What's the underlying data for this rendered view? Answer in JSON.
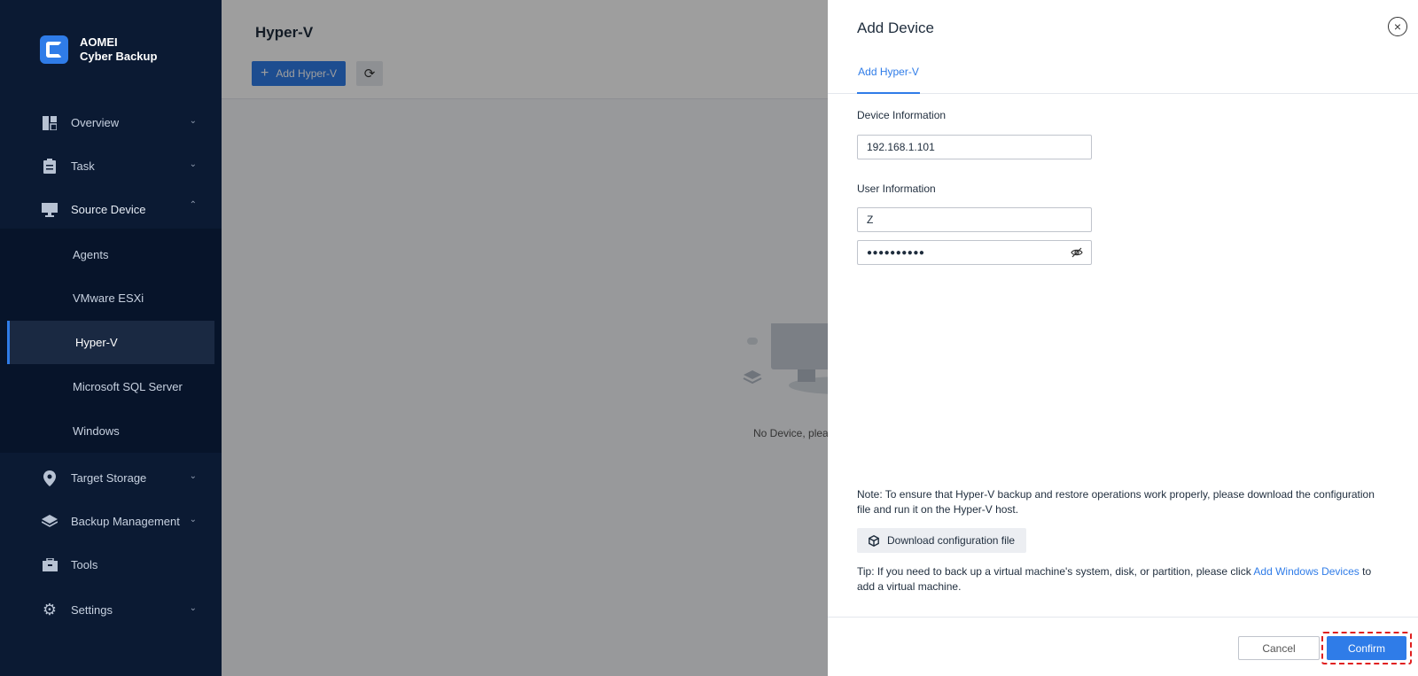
{
  "app": {
    "brand_line1": "AOMEI",
    "brand_line2": "Cyber Backup"
  },
  "sidebar": {
    "items": [
      {
        "label": "Overview",
        "icon": "overview-icon"
      },
      {
        "label": "Task",
        "icon": "task-icon"
      },
      {
        "label": "Source Device",
        "icon": "monitor-icon",
        "expanded": true
      },
      {
        "label": "Target Storage",
        "icon": "location-pin-icon"
      },
      {
        "label": "Backup Management",
        "icon": "layers-icon"
      },
      {
        "label": "Tools",
        "icon": "toolbox-icon"
      },
      {
        "label": "Settings",
        "icon": "gear-icon"
      }
    ],
    "sub_items": [
      {
        "label": "Agents"
      },
      {
        "label": "VMware ESXi"
      },
      {
        "label": "Hyper-V",
        "active": true
      },
      {
        "label": "Microsoft SQL Server"
      },
      {
        "label": "Windows"
      }
    ]
  },
  "main": {
    "title": "Hyper-V",
    "add_button": "Add Hyper-V",
    "empty_text": "No Device, pleas"
  },
  "drawer": {
    "title": "Add Device",
    "tab": "Add Hyper-V",
    "device_info_label": "Device Information",
    "device_ip": "192.168.1.101",
    "user_info_label": "User Information",
    "username": "Z",
    "password_mask": "●●●●●●●●●●",
    "note": "Note: To ensure that Hyper-V backup and restore operations work properly, please download the configuration file and run it on the Hyper-V host.",
    "download_button": "Download configuration file",
    "tip_prefix": "Tip: If you need to back up a virtual machine's system, disk, or partition, please click ",
    "tip_link": "Add Windows Devices",
    "tip_suffix": " to add a virtual machine.",
    "cancel_button": "Cancel",
    "confirm_button": "Confirm"
  },
  "colors": {
    "accent": "#2f7ce8",
    "sidebar_bg": "#0b1a33",
    "highlight": "#e02020"
  }
}
